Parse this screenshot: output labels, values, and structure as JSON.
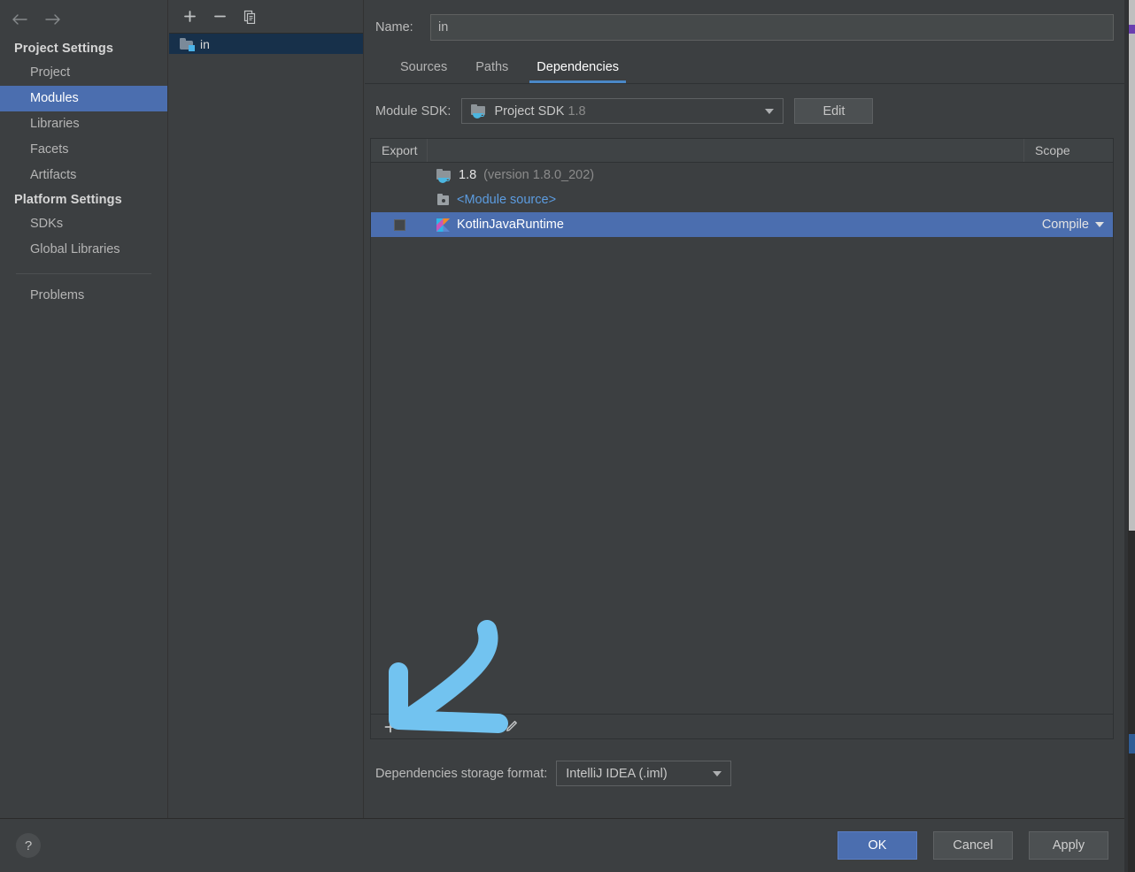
{
  "sidebar": {
    "nav": {
      "back_icon": "arrow-left-icon",
      "forward_icon": "arrow-right-icon"
    },
    "groups": [
      {
        "title": "Project Settings",
        "items": [
          {
            "label": "Project",
            "selected": false
          },
          {
            "label": "Modules",
            "selected": true
          },
          {
            "label": "Libraries",
            "selected": false
          },
          {
            "label": "Facets",
            "selected": false
          },
          {
            "label": "Artifacts",
            "selected": false
          }
        ]
      },
      {
        "title": "Platform Settings",
        "items": [
          {
            "label": "SDKs",
            "selected": false
          },
          {
            "label": "Global Libraries",
            "selected": false
          }
        ]
      }
    ],
    "problems_label": "Problems",
    "selected_color": "#4b6eaf"
  },
  "module_list": {
    "toolbar": [
      {
        "name": "add-module-button",
        "glyph": "+"
      },
      {
        "name": "remove-module-button",
        "glyph": "−"
      },
      {
        "name": "copy-module-button",
        "glyph": "copy-icon"
      }
    ],
    "rows": [
      {
        "label": "in",
        "icon": "module-folder-icon",
        "selected": true
      }
    ],
    "selected_color": "#17304a"
  },
  "main": {
    "name_label": "Name:",
    "name_value": "in",
    "name_placeholder": "",
    "tabs": [
      {
        "label": "Sources",
        "active": false
      },
      {
        "label": "Paths",
        "active": false
      },
      {
        "label": "Dependencies",
        "active": true
      }
    ],
    "tab_accent_color": "#4a88c7",
    "sdk": {
      "label": "Module SDK:",
      "value_main": "Project SDK",
      "value_dim": "1.8",
      "icon": "sdk-folder-icon",
      "edit_label": "Edit"
    },
    "table": {
      "headers": {
        "export": "Export",
        "middle": "",
        "scope": "Scope"
      },
      "rows": [
        {
          "export_checkbox": false,
          "show_checkbox": false,
          "icon": "sdk-folder-icon",
          "label_main": "1.8",
          "label_dim": "(version 1.8.0_202)",
          "label_link": "",
          "scope": "",
          "selected": false
        },
        {
          "export_checkbox": false,
          "show_checkbox": false,
          "icon": "module-source-icon",
          "label_main": "",
          "label_dim": "",
          "label_link": "<Module source>",
          "scope": "",
          "selected": false
        },
        {
          "export_checkbox": false,
          "show_checkbox": true,
          "icon": "kotlin-icon",
          "label_main": "KotlinJavaRuntime",
          "label_dim": "",
          "label_link": "",
          "scope": "Compile",
          "selected": true
        }
      ],
      "selected_color": "#4b6eaf",
      "toolbar": [
        {
          "name": "add-dependency-button",
          "glyph": "+"
        },
        {
          "name": "remove-dependency-button",
          "glyph": "−"
        },
        {
          "name": "move-up-button",
          "glyph": "triangle-up-icon"
        },
        {
          "name": "move-down-button",
          "glyph": "triangle-down-icon"
        },
        {
          "name": "edit-dependency-button",
          "glyph": "pencil-icon"
        }
      ]
    },
    "storage": {
      "label": "Dependencies storage format:",
      "value": "IntelliJ IDEA (.iml)"
    }
  },
  "annotation": {
    "type": "hand-drawn-arrow",
    "direction": "down-left",
    "color": "#72c3f0"
  },
  "footer": {
    "help_label": "?",
    "buttons": [
      {
        "label": "OK",
        "primary": true
      },
      {
        "label": "Cancel",
        "primary": false
      },
      {
        "label": "Apply",
        "primary": false
      }
    ],
    "primary_color": "#4b6eaf"
  }
}
